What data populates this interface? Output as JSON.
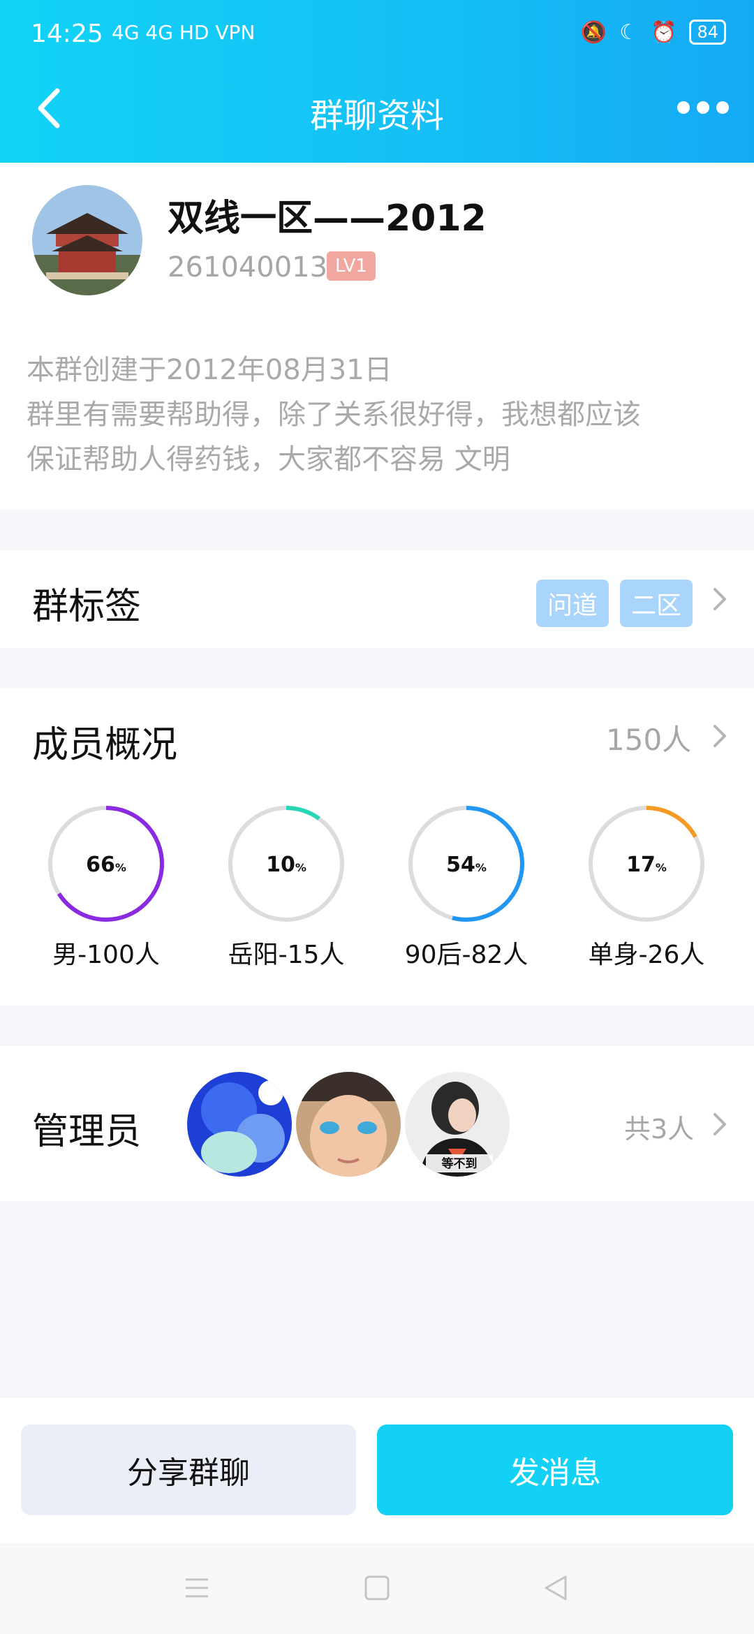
{
  "status_bar": {
    "time": "14:25",
    "network_left": "4G 4G HD VPN",
    "battery": "84"
  },
  "header": {
    "title": "群聊资料"
  },
  "group": {
    "name": "双线一区——2012",
    "id": "261040013",
    "level": "LV1",
    "description_line1": "本群创建于2012年08月31日",
    "description_line2": "群里有需要帮助得，除了关系很好得，我想都应该",
    "description_line3": "保证帮助人得药钱，大家都不容易  文明"
  },
  "tags_row": {
    "label": "群标签",
    "tags": [
      "问道",
      "二区"
    ]
  },
  "members_row": {
    "label": "成员概况",
    "count": "150人",
    "stats": [
      {
        "percent": "66",
        "unit": "%",
        "label": "男-100人",
        "fraction": 0.66,
        "color": "#8a2be2"
      },
      {
        "percent": "10",
        "unit": "%",
        "label": "岳阳-15人",
        "fraction": 0.1,
        "color": "#26d6b5"
      },
      {
        "percent": "54",
        "unit": "%",
        "label": "90后-82人",
        "fraction": 0.54,
        "color": "#2196f3"
      },
      {
        "percent": "17",
        "unit": "%",
        "label": "单身-26人",
        "fraction": 0.17,
        "color": "#f59a23"
      }
    ]
  },
  "admins_row": {
    "label": "管理员",
    "total": "共3人",
    "avatar_caption": "等不到"
  },
  "buttons": {
    "share": "分享群聊",
    "send": "发消息"
  }
}
